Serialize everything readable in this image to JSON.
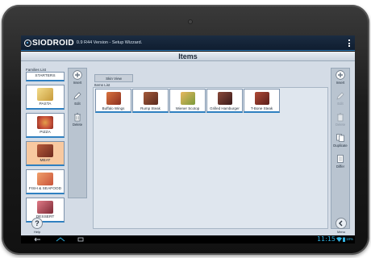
{
  "app": {
    "logo_text": "SIODROID",
    "version_title": "0.9 R44 Version - Setup Wizzard."
  },
  "page": {
    "title": "Items"
  },
  "families": {
    "label": "Families List",
    "items": [
      {
        "label": "STARTERS",
        "has_image": false,
        "active": false,
        "thumb_color": ""
      },
      {
        "label": "PASTA",
        "has_image": true,
        "active": false,
        "thumb_color": "#e3c46a"
      },
      {
        "label": "PIZZA",
        "has_image": true,
        "active": false,
        "thumb_color": "#c9533a"
      },
      {
        "label": "MEAT",
        "has_image": true,
        "active": true,
        "thumb_color": "#8e3b2a"
      },
      {
        "label": "FISH & SEAFOOD",
        "has_image": true,
        "active": false,
        "thumb_color": "#d46a3c"
      },
      {
        "label": "DESSERT",
        "has_image": true,
        "active": false,
        "thumb_color": "#9b3b46"
      }
    ]
  },
  "left_tools": {
    "insert_label": "Insert",
    "edit_label": "Edit",
    "delete_label": "Delete"
  },
  "items_panel": {
    "skin_label": "Skin View",
    "list_label": "Items List",
    "items": [
      {
        "label": "Buffalo Wings",
        "thumb_color": "#b0472c"
      },
      {
        "label": "Rump Steak",
        "thumb_color": "#7a3a28"
      },
      {
        "label": "Wiener Scotop",
        "thumb_color": "#c98a3a"
      },
      {
        "label": "Grilled Hamburger",
        "thumb_color": "#6b2c2c"
      },
      {
        "label": "T-Bone Steak",
        "thumb_color": "#8a3026"
      }
    ]
  },
  "right_tools": {
    "insert_label": "Insert",
    "edit_label": "Edit",
    "delete_label": "Delete",
    "duplicate_label": "Duplicate",
    "differ_label": "Differ"
  },
  "bottom": {
    "help_label": "Help",
    "menu_label": "Menu"
  },
  "status": {
    "clock": "11:15",
    "battery": "18%"
  },
  "colors": {
    "accent": "#2f80c0",
    "status_accent": "#33b5e5",
    "active_family": "#f8c9a0"
  },
  "icons": [
    "overflow-menu-icon",
    "plus-icon",
    "pencil-icon",
    "trash-icon",
    "duplicate-icon",
    "differ-icon",
    "help-icon",
    "menu-icon",
    "back-icon",
    "home-icon",
    "recent-apps-icon",
    "wifi-icon",
    "battery-icon"
  ]
}
